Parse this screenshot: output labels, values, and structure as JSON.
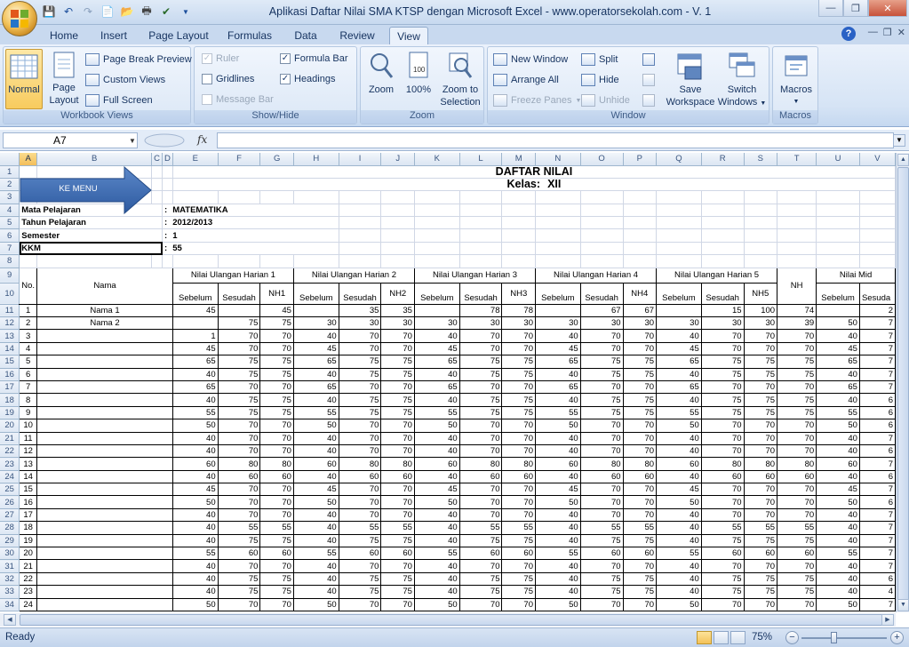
{
  "window": {
    "title": "Aplikasi Daftar Nilai SMA KTSP dengan Microsoft Excel - www.operatorsekolah.com - V. 1"
  },
  "ribbon": {
    "tabs": [
      "Home",
      "Insert",
      "Page Layout",
      "Formulas",
      "Data",
      "Review",
      "View"
    ],
    "active_tab": "View",
    "workbook_views": {
      "label": "Workbook Views",
      "normal": "Normal",
      "page_layout_1": "Page",
      "page_layout_2": "Layout",
      "page_break_preview": "Page Break Preview",
      "custom_views": "Custom Views",
      "full_screen": "Full Screen"
    },
    "show_hide": {
      "label": "Show/Hide",
      "ruler": "Ruler",
      "gridlines": "Gridlines",
      "message_bar": "Message Bar",
      "formula_bar": "Formula Bar",
      "headings": "Headings"
    },
    "zoom": {
      "label": "Zoom",
      "zoom": "Zoom",
      "hundred": "100%",
      "zoom_sel_1": "Zoom to",
      "zoom_sel_2": "Selection"
    },
    "window": {
      "label": "Window",
      "new_window": "New Window",
      "arrange_all": "Arrange All",
      "freeze_panes": "Freeze Panes",
      "split": "Split",
      "hide": "Hide",
      "unhide": "Unhide",
      "save_ws_1": "Save",
      "save_ws_2": "Workspace",
      "switch_1": "Switch",
      "switch_2": "Windows"
    },
    "macros": {
      "label": "Macros",
      "macros": "Macros"
    }
  },
  "formula": {
    "name_box": "A7",
    "fx": "fx",
    "value": ""
  },
  "columns": [
    "A",
    "B",
    "C",
    "D",
    "E",
    "F",
    "G",
    "H",
    "I",
    "J",
    "K",
    "L",
    "M",
    "N",
    "O",
    "P",
    "Q",
    "R",
    "S",
    "T",
    "U",
    "V"
  ],
  "sheet": {
    "title": "DAFTAR NILAI",
    "kelas_label": "Kelas:",
    "kelas_value": "XII",
    "menu_button": "KE MENU",
    "info": [
      {
        "label": "Mata Pelajaran",
        "sep": ":",
        "value": "MATEMATIKA"
      },
      {
        "label": "Tahun Pelajaran",
        "sep": ":",
        "value": "2012/2013"
      },
      {
        "label": "Semester",
        "sep": ":",
        "value": "1"
      },
      {
        "label": "KKM",
        "sep": ":",
        "value": "55"
      }
    ],
    "header": {
      "no": "No.",
      "nama": "Nama",
      "uh": [
        "Nilai Ulangan Harian 1",
        "Nilai Ulangan Harian 2",
        "Nilai Ulangan Harian 3",
        "Nilai Ulangan Harian 4",
        "Nilai Ulangan Harian 5"
      ],
      "sebelum": "Sebelum",
      "sesudah": "Sesudah",
      "nh": [
        "NH1",
        "NH2",
        "NH3",
        "NH4",
        "NH5"
      ],
      "nh_total": "NH",
      "mid": "Nilai Mid",
      "mid_sebelum": "Sebelum",
      "mid_sesudah": "Sesuda"
    },
    "rows": [
      {
        "no": "1",
        "nama": "Nama 1",
        "v": [
          "45",
          "",
          "45",
          "",
          "35",
          "35",
          "",
          "78",
          "78",
          "",
          "67",
          "67",
          "",
          "15",
          "100",
          "74",
          "",
          "2"
        ]
      },
      {
        "no": "2",
        "nama": "Nama 2",
        "v": [
          "",
          "75",
          "75",
          "30",
          "30",
          "30",
          "30",
          "30",
          "30",
          "30",
          "30",
          "30",
          "30",
          "30",
          "30",
          "39",
          "50",
          "7"
        ]
      },
      {
        "no": "3",
        "nama": "",
        "v": [
          "1",
          "70",
          "70",
          "40",
          "70",
          "70",
          "40",
          "70",
          "70",
          "40",
          "70",
          "70",
          "40",
          "70",
          "70",
          "70",
          "40",
          "7"
        ]
      },
      {
        "no": "4",
        "nama": "",
        "v": [
          "45",
          "70",
          "70",
          "45",
          "70",
          "70",
          "45",
          "70",
          "70",
          "45",
          "70",
          "70",
          "45",
          "70",
          "70",
          "70",
          "45",
          "7"
        ]
      },
      {
        "no": "5",
        "nama": "",
        "v": [
          "65",
          "75",
          "75",
          "65",
          "75",
          "75",
          "65",
          "75",
          "75",
          "65",
          "75",
          "75",
          "65",
          "75",
          "75",
          "75",
          "65",
          "7"
        ]
      },
      {
        "no": "6",
        "nama": "",
        "v": [
          "40",
          "75",
          "75",
          "40",
          "75",
          "75",
          "40",
          "75",
          "75",
          "40",
          "75",
          "75",
          "40",
          "75",
          "75",
          "75",
          "40",
          "7"
        ]
      },
      {
        "no": "7",
        "nama": "",
        "v": [
          "65",
          "70",
          "70",
          "65",
          "70",
          "70",
          "65",
          "70",
          "70",
          "65",
          "70",
          "70",
          "65",
          "70",
          "70",
          "70",
          "65",
          "7"
        ]
      },
      {
        "no": "8",
        "nama": "",
        "v": [
          "40",
          "75",
          "75",
          "40",
          "75",
          "75",
          "40",
          "75",
          "75",
          "40",
          "75",
          "75",
          "40",
          "75",
          "75",
          "75",
          "40",
          "6"
        ]
      },
      {
        "no": "9",
        "nama": "",
        "v": [
          "55",
          "75",
          "75",
          "55",
          "75",
          "75",
          "55",
          "75",
          "75",
          "55",
          "75",
          "75",
          "55",
          "75",
          "75",
          "75",
          "55",
          "6"
        ]
      },
      {
        "no": "10",
        "nama": "",
        "v": [
          "50",
          "70",
          "70",
          "50",
          "70",
          "70",
          "50",
          "70",
          "70",
          "50",
          "70",
          "70",
          "50",
          "70",
          "70",
          "70",
          "50",
          "6"
        ]
      },
      {
        "no": "11",
        "nama": "",
        "v": [
          "40",
          "70",
          "70",
          "40",
          "70",
          "70",
          "40",
          "70",
          "70",
          "40",
          "70",
          "70",
          "40",
          "70",
          "70",
          "70",
          "40",
          "7"
        ]
      },
      {
        "no": "12",
        "nama": "",
        "v": [
          "40",
          "70",
          "70",
          "40",
          "70",
          "70",
          "40",
          "70",
          "70",
          "40",
          "70",
          "70",
          "40",
          "70",
          "70",
          "70",
          "40",
          "6"
        ]
      },
      {
        "no": "13",
        "nama": "",
        "v": [
          "60",
          "80",
          "80",
          "60",
          "80",
          "80",
          "60",
          "80",
          "80",
          "60",
          "80",
          "80",
          "60",
          "80",
          "80",
          "80",
          "60",
          "7"
        ]
      },
      {
        "no": "14",
        "nama": "",
        "v": [
          "40",
          "60",
          "60",
          "40",
          "60",
          "60",
          "40",
          "60",
          "60",
          "40",
          "60",
          "60",
          "40",
          "60",
          "60",
          "60",
          "40",
          "6"
        ]
      },
      {
        "no": "15",
        "nama": "",
        "v": [
          "45",
          "70",
          "70",
          "45",
          "70",
          "70",
          "45",
          "70",
          "70",
          "45",
          "70",
          "70",
          "45",
          "70",
          "70",
          "70",
          "45",
          "7"
        ]
      },
      {
        "no": "16",
        "nama": "",
        "v": [
          "50",
          "70",
          "70",
          "50",
          "70",
          "70",
          "50",
          "70",
          "70",
          "50",
          "70",
          "70",
          "50",
          "70",
          "70",
          "70",
          "50",
          "6"
        ]
      },
      {
        "no": "17",
        "nama": "",
        "v": [
          "40",
          "70",
          "70",
          "40",
          "70",
          "70",
          "40",
          "70",
          "70",
          "40",
          "70",
          "70",
          "40",
          "70",
          "70",
          "70",
          "40",
          "7"
        ]
      },
      {
        "no": "18",
        "nama": "",
        "v": [
          "40",
          "55",
          "55",
          "40",
          "55",
          "55",
          "40",
          "55",
          "55",
          "40",
          "55",
          "55",
          "40",
          "55",
          "55",
          "55",
          "40",
          "7"
        ]
      },
      {
        "no": "19",
        "nama": "",
        "v": [
          "40",
          "75",
          "75",
          "40",
          "75",
          "75",
          "40",
          "75",
          "75",
          "40",
          "75",
          "75",
          "40",
          "75",
          "75",
          "75",
          "40",
          "7"
        ]
      },
      {
        "no": "20",
        "nama": "",
        "v": [
          "55",
          "60",
          "60",
          "55",
          "60",
          "60",
          "55",
          "60",
          "60",
          "55",
          "60",
          "60",
          "55",
          "60",
          "60",
          "60",
          "55",
          "7"
        ]
      },
      {
        "no": "21",
        "nama": "",
        "v": [
          "40",
          "70",
          "70",
          "40",
          "70",
          "70",
          "40",
          "70",
          "70",
          "40",
          "70",
          "70",
          "40",
          "70",
          "70",
          "70",
          "40",
          "7"
        ]
      },
      {
        "no": "22",
        "nama": "",
        "v": [
          "40",
          "75",
          "75",
          "40",
          "75",
          "75",
          "40",
          "75",
          "75",
          "40",
          "75",
          "75",
          "40",
          "75",
          "75",
          "75",
          "40",
          "6"
        ]
      },
      {
        "no": "23",
        "nama": "",
        "v": [
          "40",
          "75",
          "75",
          "40",
          "75",
          "75",
          "40",
          "75",
          "75",
          "40",
          "75",
          "75",
          "40",
          "75",
          "75",
          "75",
          "40",
          "4"
        ]
      },
      {
        "no": "24",
        "nama": "",
        "v": [
          "50",
          "70",
          "70",
          "50",
          "70",
          "70",
          "50",
          "70",
          "70",
          "50",
          "70",
          "70",
          "50",
          "70",
          "70",
          "70",
          "50",
          "7"
        ]
      }
    ],
    "row_numbers_top": [
      "1",
      "2",
      "3",
      "4",
      "5",
      "6",
      "7",
      "8",
      "9",
      "10"
    ],
    "row_numbers_data": [
      "11",
      "12",
      "13",
      "14",
      "15",
      "16",
      "17",
      "18",
      "19",
      "20",
      "21",
      "22",
      "23",
      "24",
      "25",
      "26",
      "27",
      "28",
      "29",
      "30",
      "31",
      "32",
      "33",
      "34"
    ]
  },
  "status": {
    "text": "Ready",
    "zoom": "75%"
  },
  "colors": {
    "ribbon_bg": "#dbe7f6",
    "arrow": "#3e6eb4",
    "header_bg": "#dde7f4"
  }
}
